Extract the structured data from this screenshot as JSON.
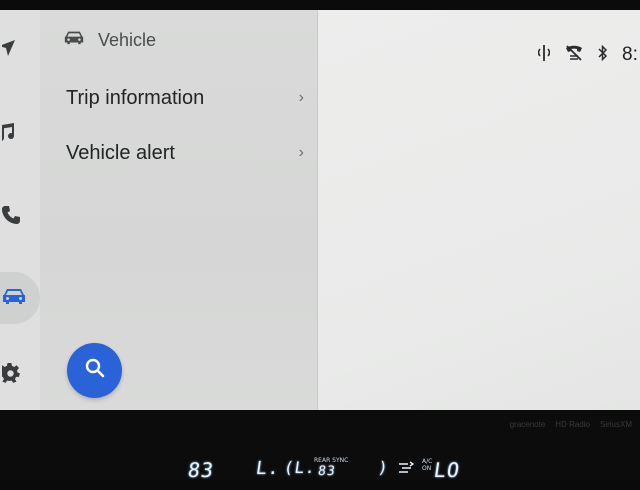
{
  "nav_rail": {
    "items": [
      {
        "id": "navigation",
        "icon": "navigation-arrow-icon"
      },
      {
        "id": "media",
        "icon": "music-note-icon"
      },
      {
        "id": "phone",
        "icon": "phone-icon"
      },
      {
        "id": "vehicle",
        "icon": "car-icon",
        "active": true
      },
      {
        "id": "settings",
        "icon": "gear-icon"
      }
    ]
  },
  "panel": {
    "header_icon": "car-icon",
    "title": "Vehicle",
    "items": [
      {
        "label": "Trip information"
      },
      {
        "label": "Vehicle alert"
      }
    ],
    "search_icon": "search-icon"
  },
  "status_bar": {
    "icons": [
      "wireless-charging-icon",
      "phone-muted-icon",
      "bluetooth-icon"
    ],
    "time": "8:"
  },
  "bezel": {
    "brands": [
      "gracenote",
      "HD Radio",
      "SiriusXM"
    ]
  },
  "climate": {
    "left_temp": "83",
    "rear_label": "REAR SYNC",
    "rear_temp": "83",
    "ac_label": "A/C ON",
    "right_temp": "LO"
  },
  "colors": {
    "accent": "#2a62d8",
    "rail_icon": "#3a3d40",
    "active_icon": "#2a62d8"
  }
}
